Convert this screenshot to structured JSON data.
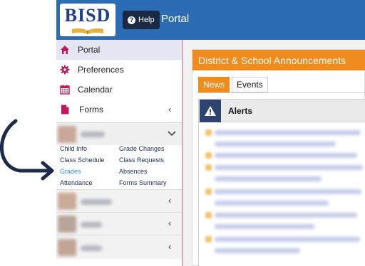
{
  "header": {
    "logo_text": "BISD",
    "help_label": "Help",
    "portal_title": "Portal"
  },
  "sidebar": {
    "items": [
      {
        "label": "Portal",
        "icon": "home-icon"
      },
      {
        "label": "Preferences",
        "icon": "gear-icon"
      },
      {
        "label": "Calendar",
        "icon": "calendar-icon"
      },
      {
        "label": "Forms",
        "icon": "document-icon"
      }
    ],
    "student_links": {
      "col1": [
        "Child Info",
        "Class Schedule",
        "Grades",
        "Attendance"
      ],
      "col2": [
        "Grade Changes",
        "Class Requests",
        "Absences",
        "Forms Summary"
      ],
      "selected": "Grades"
    }
  },
  "main": {
    "announcements_title": "District & School Announcements",
    "tabs": [
      "News",
      "Events"
    ],
    "active_tab": "News",
    "alerts_title": "Alerts"
  },
  "colors": {
    "header_blue": "#2b6cb5",
    "orange": "#f08b1e",
    "nav_icon_red": "#c2185b",
    "alerts_navy": "#2d4470",
    "link_selected": "#2e8fd8",
    "annotation_arrow": "#1c2b47"
  }
}
